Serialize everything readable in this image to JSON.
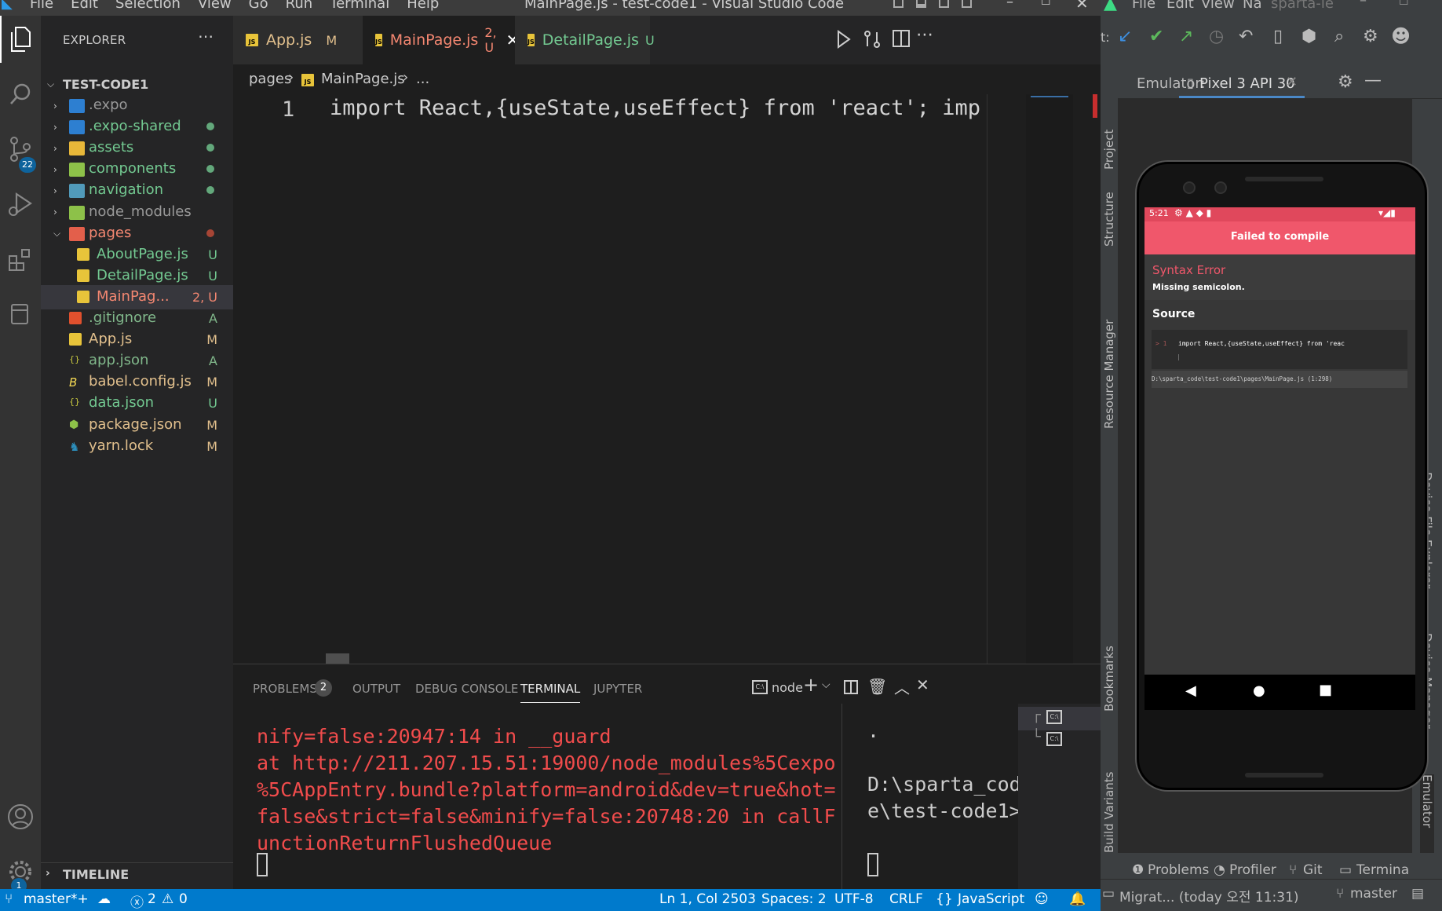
{
  "vscode": {
    "window_title": "MainPage.js - test-code1 - Visual Studio Code",
    "menu": [
      "File",
      "Edit",
      "Selection",
      "View",
      "Go",
      "Run",
      "Terminal",
      "Help"
    ],
    "activity_badges": {
      "scm": "22",
      "settings": "1"
    },
    "explorer": {
      "title": "EXPLORER",
      "root": "TEST-CODE1",
      "items": [
        {
          "name": ".expo",
          "status": "",
          "dot": ""
        },
        {
          "name": ".expo-shared",
          "status": "",
          "dot": "#73c991"
        },
        {
          "name": "assets",
          "status": "",
          "dot": "#73c991"
        },
        {
          "name": "components",
          "status": "",
          "dot": "#73c991"
        },
        {
          "name": "navigation",
          "status": "",
          "dot": "#73c991"
        },
        {
          "name": "node_modules",
          "status": "",
          "dot": ""
        },
        {
          "name": "pages",
          "status": "",
          "dot": "#c74e39"
        },
        {
          "name": "AboutPage.js",
          "status": "U"
        },
        {
          "name": "DetailPage.js",
          "status": "U"
        },
        {
          "name": "MainPag...",
          "status": "2, U"
        },
        {
          "name": ".gitignore",
          "status": "A"
        },
        {
          "name": "App.js",
          "status": "M"
        },
        {
          "name": "app.json",
          "status": "A"
        },
        {
          "name": "babel.config.js",
          "status": "M"
        },
        {
          "name": "data.json",
          "status": "U"
        },
        {
          "name": "package.json",
          "status": "M"
        },
        {
          "name": "yarn.lock",
          "status": "M"
        }
      ],
      "timeline": "TIMELINE"
    },
    "tabs": [
      {
        "label": "App.js",
        "status": "M"
      },
      {
        "label": "MainPage.js",
        "status": "2, U"
      },
      {
        "label": "DetailPage.js",
        "status": "U"
      }
    ],
    "breadcrumb": {
      "folder": "pages",
      "file": "MainPage.js",
      "rest": "..."
    },
    "editor": {
      "line_number": "1",
      "code": "import React,{useState,useEffect} from 'react'; import {"
    },
    "panel": {
      "tabs": [
        "PROBLEMS",
        "OUTPUT",
        "DEBUG CONSOLE",
        "TERMINAL",
        "JUPYTER"
      ],
      "problems_count": "2",
      "terminal_name": "node",
      "terminal_output": "nify=false:20947:14 in __guard\nat http://211.207.15.51:19000/node_modules%5Cexpo\n%5CAppEntry.bundle?platform=android&dev=true&hot=\nfalse&strict=false&minify=false:20748:20 in callF\nunctionReturnFlushedQueue",
      "terminal2_output": ".\n\nD:\\sparta_cod\ne\\test-code1>"
    },
    "status": {
      "branch": "master*+",
      "errors": "2",
      "warnings": "0",
      "position": "Ln 1, Col 2503",
      "spaces": "Spaces: 2",
      "encoding": "UTF-8",
      "eol": "CRLF",
      "language": "JavaScript"
    }
  },
  "studio": {
    "menu": [
      "File",
      "Edit",
      "View",
      "Na",
      "sparta-le"
    ],
    "emulator_label": "Emulator:",
    "device_tab": "Pixel 3 API 30",
    "left_tabs": [
      "Project",
      "Structure",
      "Resource Manager",
      "Bookmarks",
      "Build Variants"
    ],
    "right_tabs": [
      "Device File Explorer",
      "Device Manager",
      "Emulator"
    ],
    "bottom_tabs": [
      "Problems",
      "Profiler",
      "Git",
      "Termina"
    ],
    "status_text": "Migrat... (today 오전 11:31)",
    "branch": "master",
    "phone": {
      "time": "5:21",
      "banner": "Failed to compile",
      "error_title": "Syntax Error",
      "error_msg": "Missing semicolon.",
      "source_title": "Source",
      "source_line_no": "> 1",
      "source_code": "import React,{useState,useEffect} from 'reac",
      "source_caret": "|",
      "source_path": "D:\\sparta_code\\test-code1\\pages\\MainPage.js (1:298)"
    }
  }
}
